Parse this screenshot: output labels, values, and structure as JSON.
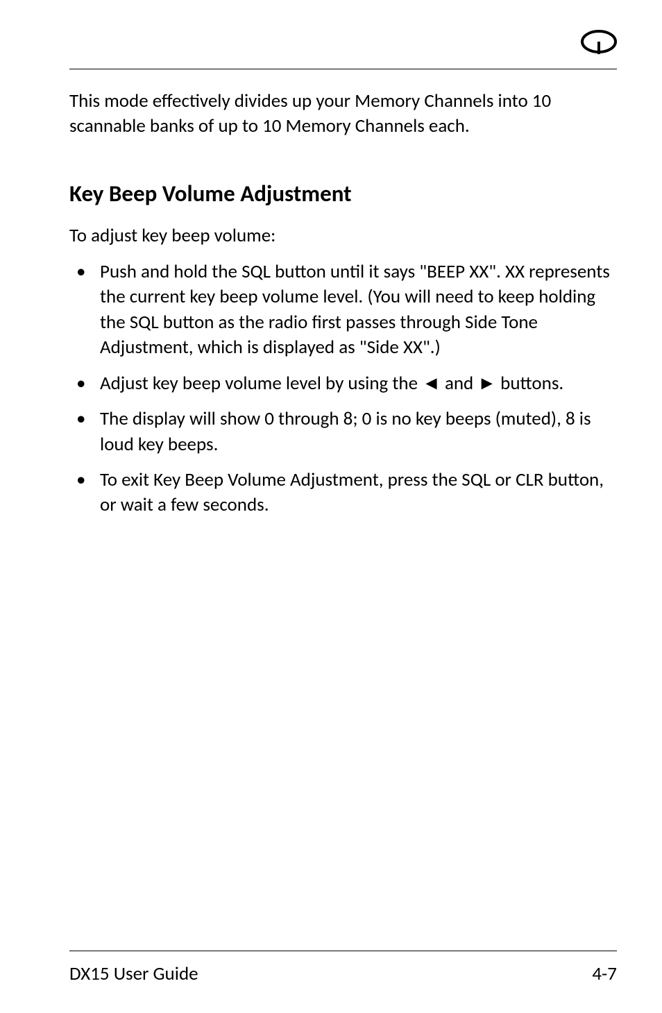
{
  "intro": "This mode effectively divides up your Memory Channels into 10 scannable banks of up to 10 Memory Channels each.",
  "heading": "Key Beep Volume Adjustment",
  "subtext": " To adjust key beep volume:",
  "bullets": [
    "Push and hold the SQL button until it says \"BEEP XX\". XX represents the current key beep volume level. (You will need to keep holding the SQL button as the radio first passes through Side Tone Adjustment, which is displayed as \"Side XX\".)",
    "Adjust key beep volume level by using the ◄ and ► buttons.",
    "The display will show 0 through 8; 0 is no key beeps (muted), 8 is loud key beeps.",
    "To exit Key Beep Volume Adjustment, press the SQL or CLR button, or wait a few seconds."
  ],
  "footer": {
    "title": "DX15 User Guide",
    "page": "4-7"
  }
}
